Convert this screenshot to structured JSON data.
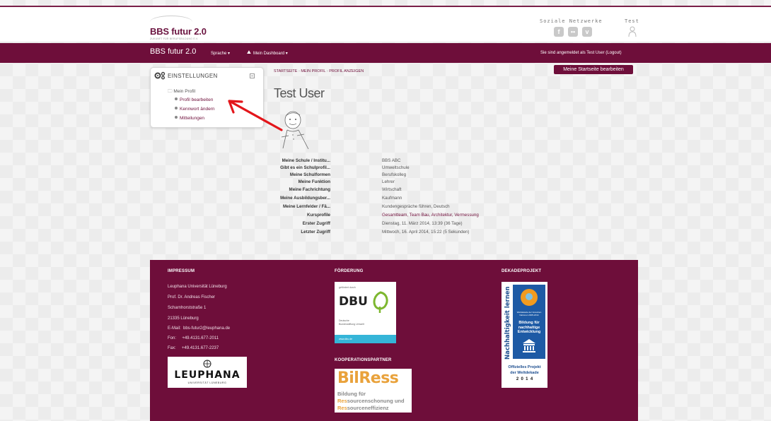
{
  "brand": {
    "logo_title": "BBS futur 2.0",
    "logo_subtitle": "ZUKUNFT FÜR BERUFSBILDUNG E.V."
  },
  "header": {
    "social_label": "Soziale Netzwerke",
    "user_label": "Test",
    "social_icons": [
      "facebook-icon",
      "flickr-icon",
      "vimeo-icon"
    ]
  },
  "navbar": {
    "brand": "BBS futur 2.0",
    "language_menu": "Sprache ▾",
    "dashboard_menu": "Mein Dashboard ▾",
    "logged_in_text": "Sie sind angemeldet als Test User (Logout)"
  },
  "settings": {
    "title": "EINSTELLUNGEN",
    "folder": "Mein Profil",
    "items": [
      "Profil bearbeiten",
      "Kennwort ändern",
      "Mitteilungen"
    ]
  },
  "breadcrumb": {
    "items": [
      "STARTSEITE",
      "MEIN PROFIL",
      "PROFIL ANZEIGEN"
    ],
    "separator": "›"
  },
  "main": {
    "edit_home_button": "Meine Startseite bearbeiten",
    "title": "Test User",
    "profile": [
      {
        "label": "Meine Schule / Institu...",
        "value": "BBS ABC"
      },
      {
        "label": "Gibt es ein Schulprofil...",
        "value": "Umweltschule"
      },
      {
        "label": "Meine Schulformen",
        "value": "Berufskolleg"
      },
      {
        "label": "Meine Funktion",
        "value": "Lehrer"
      },
      {
        "label": "Meine Fachrichtung",
        "value": "Wirtschaft"
      },
      {
        "label": "Meine Ausbildungsber...",
        "value": "Kaufmann"
      },
      {
        "label": "Meine Lernfelder / Fä...",
        "value": "Kundengespräche führen, Deutsch"
      },
      {
        "label": "Kursprofile",
        "value": "Gesamtteam, Team Bau, Architektur, Vermessung"
      },
      {
        "label": "Erster Zugriff",
        "value": "Dienstag, 11. März 2014, 13:39  (36 Tage)"
      },
      {
        "label": "Letzter Zugriff",
        "value": "Mittwoch, 16. April 2014, 15:22  (5 Sekunden)"
      }
    ]
  },
  "footer": {
    "impressum": {
      "heading": "IMPRESSUM",
      "lines": [
        "Leuphana Universität Lüneburg",
        "Prof. Dr. Andreas Fischer",
        "Scharnhorststraße 1",
        "21335 Lüneburg",
        "E-Mail:  bbs-futur2@leuphana.de",
        "Fon:     +49.4131.677-2011",
        "Fax:     +49.4131.677-2237"
      ],
      "logo_text": "LEUPHANA",
      "logo_sub": "UNIVERSITÄT LÜNEBURG"
    },
    "foerderung": {
      "heading": "FÖRDERUNG",
      "dbu_top": "gefördert durch",
      "dbu_name": "DBU",
      "dbu_sub1": "Deutsche",
      "dbu_sub2": "Bundesstiftung Umwelt",
      "dbu_url": "www.dbu.de"
    },
    "kooperation": {
      "heading": "KOOPERATIONSPARTNER",
      "logo_name": "BilRess",
      "line1": "Bildung für",
      "line2_prefix": "Res",
      "line2_rest": "sourcenschonung und",
      "line3_prefix": "Res",
      "line3_rest": "sourceneffizienz"
    },
    "dekade": {
      "heading": "DEKADEPROJEKT",
      "vertical_text": "Nachhaltigkeit lernen",
      "badge_small": "Weltdekade der Vereinten Nationen 2005-2014",
      "badge_big": "Bildung für nachhaltige Entwicklung",
      "official1": "Offizielles Projekt",
      "official2": "der Weltdekade",
      "years": "2  0  1  4"
    }
  },
  "colors": {
    "brand": "#6e0e3a",
    "arrow": "#e3161b"
  }
}
